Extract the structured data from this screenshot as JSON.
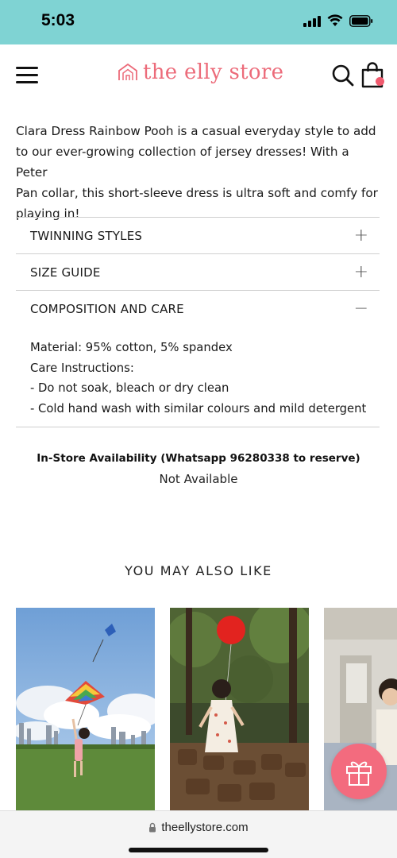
{
  "status_bar": {
    "time": "5:03",
    "icons": [
      "cellular-signal-icon",
      "wifi-icon",
      "battery-icon"
    ]
  },
  "header": {
    "logo_text": "the elly store",
    "icons": [
      "hamburger-menu-icon",
      "house-logo-icon",
      "search-icon",
      "shopping-bag-icon"
    ],
    "cart_badge_color": "#f05a6e"
  },
  "description": {
    "lines": [
      "Clara Dress Rainbow Pooh is a casual everyday style to add",
      "to our ever-growing collection of jersey dresses! With a Peter",
      "Pan collar, this short-sleeve dress is ultra soft and comfy for",
      "playing in!"
    ]
  },
  "accordion": {
    "items": [
      {
        "title": "TWINNING STYLES",
        "sign": "+"
      },
      {
        "title": "SIZE GUIDE",
        "sign": "+"
      },
      {
        "title": "COMPOSITION AND CARE",
        "sign": "−"
      }
    ],
    "open_content": [
      "Material: 95% cotton, 5% spandex",
      "Care Instructions:",
      "- Do not soak, bleach or dry clean",
      "- Cold hand wash with similar colours and mild detergent"
    ]
  },
  "availability": {
    "title": "In-Store Availability (Whatsapp 96280338 to reserve)",
    "value": "Not Available"
  },
  "recommendations": {
    "heading": "YOU MAY ALSO LIKE",
    "products": [
      {
        "image": "girl-flying-rainbow-kite-photo"
      },
      {
        "image": "girl-with-red-balloon-on-tree-stumps-photo"
      },
      {
        "image": "child-in-hallway-photo"
      }
    ]
  },
  "gift_button": {
    "icon": "gift-icon",
    "color": "#f36b7e"
  },
  "browser": {
    "url": "theellystore.com",
    "icon": "lock-icon"
  },
  "colors": {
    "status_bar": "#7fd3d3",
    "brand": "#ec6b7a",
    "divider": "#cfcfcf"
  }
}
